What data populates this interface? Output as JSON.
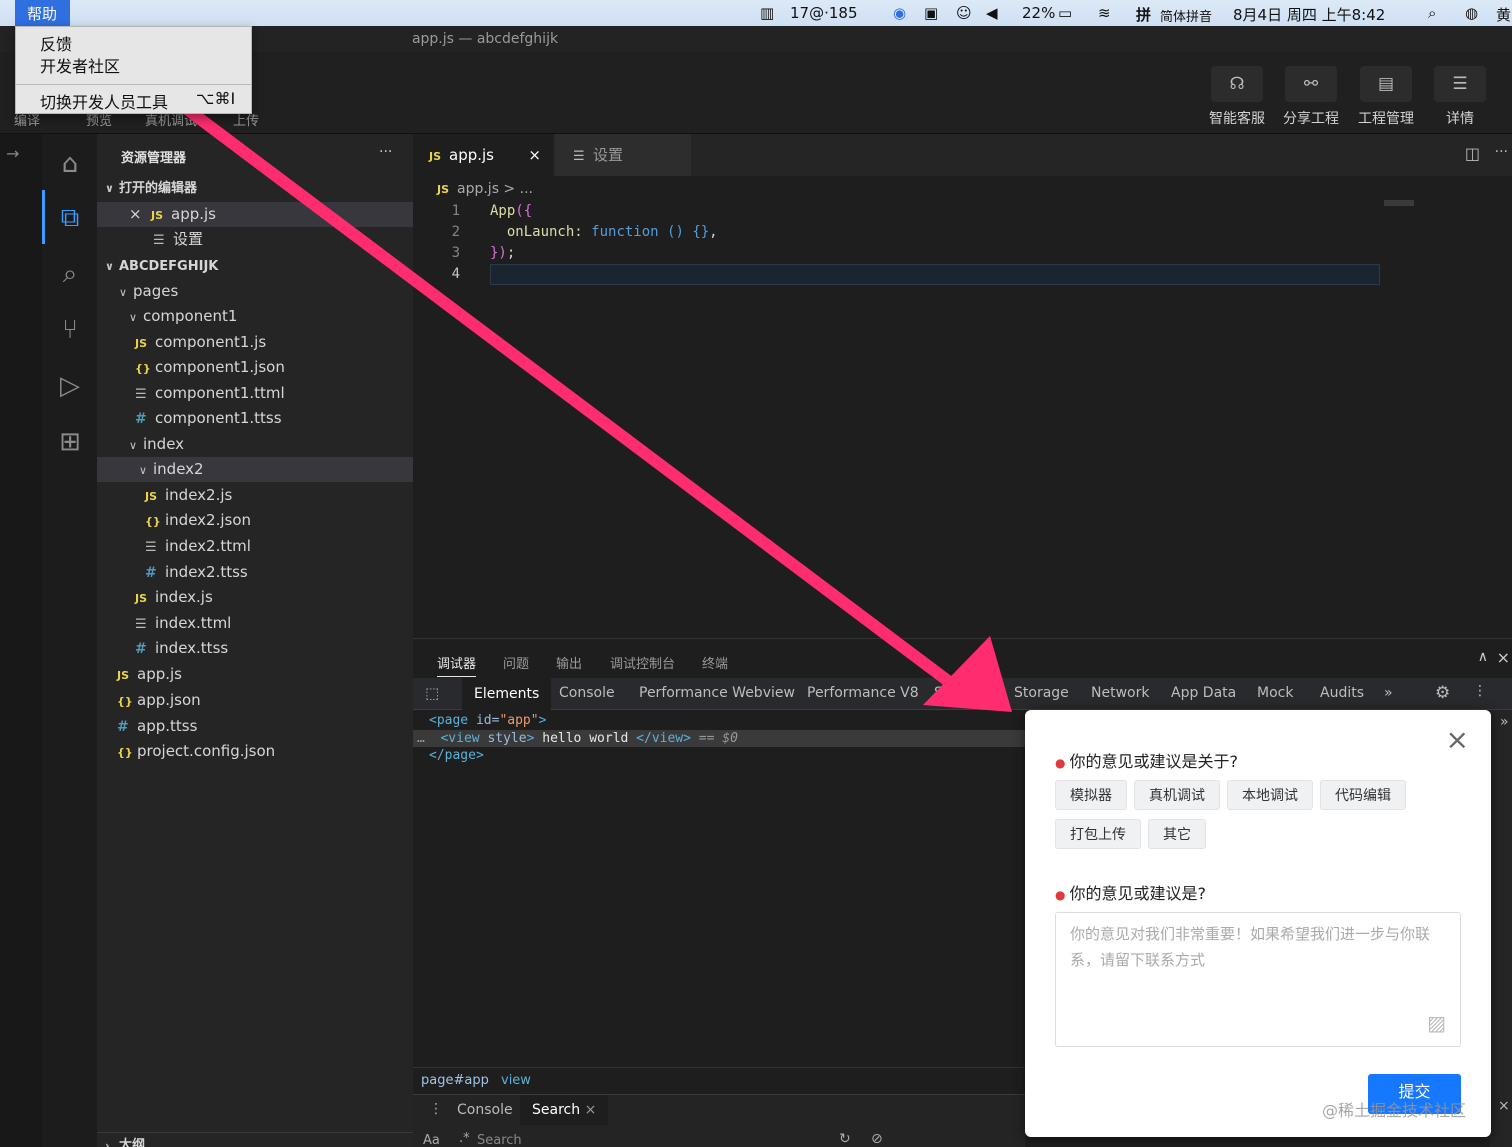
{
  "menubar": {
    "help": "帮助",
    "qq_status": "17@·185",
    "battery": "22%",
    "input_method": "简体拼音",
    "datetime": "8月4日 周四 上午8:42",
    "user_initial": "黄"
  },
  "help_menu": {
    "feedback": "反馈",
    "community": "开发者社区",
    "toggle_devtools": "切换开发人员工具",
    "toggle_shortcut": "⌥⌘I"
  },
  "window": {
    "title": "app.js — abcdefghijk"
  },
  "toolbar": {
    "left": [
      "编译",
      "预览",
      "真机调试",
      "上传"
    ],
    "buttons": [
      {
        "label": "智能客服",
        "icon": "headset-icon"
      },
      {
        "label": "分享工程",
        "icon": "share-icon"
      },
      {
        "label": "工程管理",
        "icon": "clipboard-icon"
      },
      {
        "label": "详情",
        "icon": "details-icon"
      }
    ]
  },
  "explorer": {
    "title": "资源管理器",
    "more": "···",
    "open_editors": "打开的编辑器",
    "open_files": [
      "app.js",
      "设置"
    ],
    "project": "ABCDEFGHIJK",
    "tree": {
      "pages": "pages",
      "component1": "component1",
      "component1_js": "component1.js",
      "component1_json": "component1.json",
      "component1_ttml": "component1.ttml",
      "component1_ttss": "component1.ttss",
      "index": "index",
      "index2": "index2",
      "index2_js": "index2.js",
      "index2_json": "index2.json",
      "index2_ttml": "index2.ttml",
      "index2_ttss": "index2.ttss",
      "index_js": "index.js",
      "index_ttml": "index.ttml",
      "index_ttss": "index.ttss",
      "app_js": "app.js",
      "app_json": "app.json",
      "app_ttss": "app.ttss",
      "project_config": "project.config.json"
    },
    "outline": "大纲"
  },
  "editor": {
    "tabs": [
      "app.js",
      "设置"
    ],
    "breadcrumb": "app.js > ...",
    "lines": [
      "1",
      "2",
      "3",
      "4"
    ],
    "code": {
      "l1_a": "App",
      "l1_b": "({",
      "l2_a": "  onLaunch: ",
      "l2_b": "function",
      "l2_c": " () ",
      "l2_d": "{}",
      "l2_e": ",",
      "l3_a": "})",
      "l3_b": ";"
    }
  },
  "panel": {
    "tabs": [
      "调试器",
      "问题",
      "输出",
      "调试控制台",
      "终端"
    ],
    "devtools_tabs": [
      "Elements",
      "Console",
      "Performance Webview",
      "Performance V8",
      "S",
      "Storage",
      "Network",
      "App Data",
      "Mock",
      "Audits",
      "»"
    ],
    "dom": {
      "l1_tag": "<page",
      "l1_attr": " id=",
      "l1_val": "\"app\"",
      "l1_end": ">",
      "l2_dots": "…",
      "l2_tag": "<view",
      "l2_attr": " style",
      "l2_end": ">",
      "l2_text": " hello world ",
      "l2_close": "</view>",
      "l2_eq": " == $0",
      "l3": "</page>"
    },
    "crumbs": [
      "page#app",
      "view"
    ],
    "drawer_tabs": [
      "Console",
      "Search"
    ],
    "search_aa": "Aa",
    "search_regex": ".*",
    "search_placeholder": "Search"
  },
  "dialog": {
    "q1": "你的意见或建议是关于?",
    "options": [
      "模拟器",
      "真机调试",
      "本地调试",
      "代码编辑",
      "打包上传",
      "其它"
    ],
    "q2": "你的意见或建议是?",
    "placeholder": "你的意见对我们非常重要！如果希望我们进一步与你联系，请留下联系方式",
    "submit": "提交",
    "close": "×"
  },
  "watermark": "@稀土掘金技术社区",
  "colors": {
    "accent": "#1677ff",
    "arrow": "#ff2d6f",
    "active": "#3b9bff"
  }
}
